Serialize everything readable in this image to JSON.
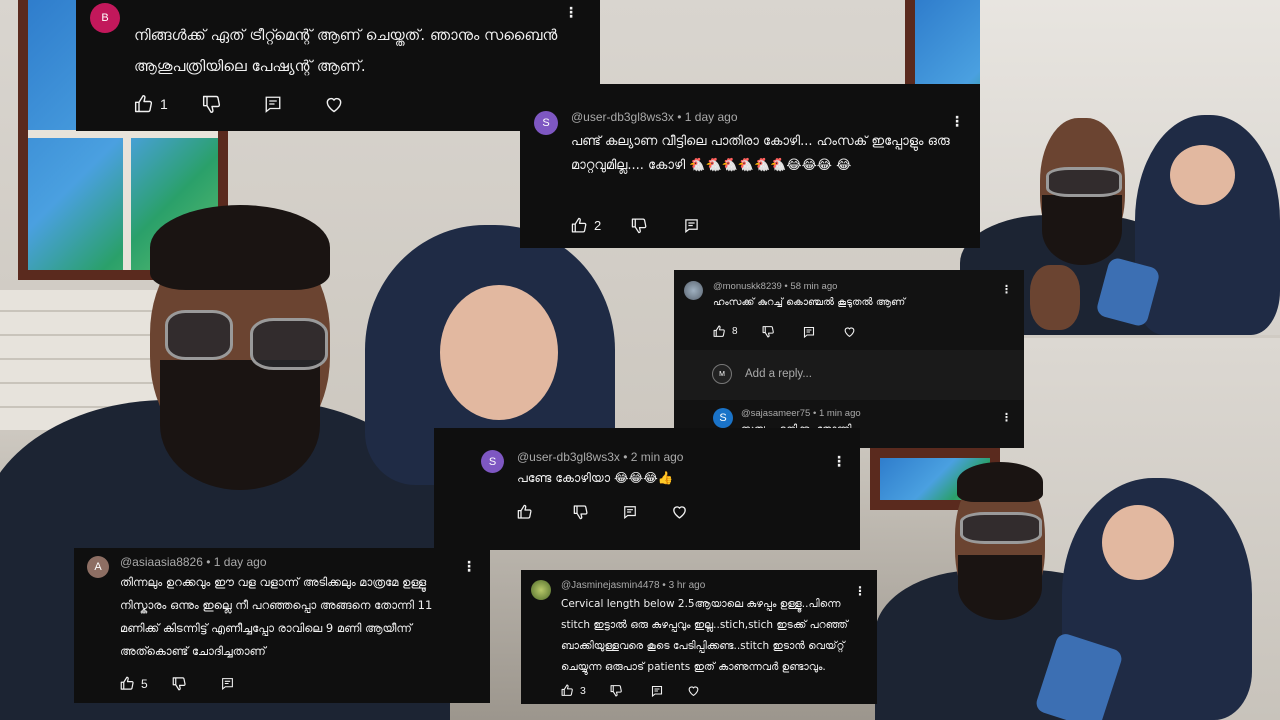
{
  "colors": {
    "card_bg": "#0f0f0f",
    "text": "#f1f1f1",
    "meta": "#aaaaaa",
    "avatar_purple": "#7e57c2",
    "avatar_blue": "#1a73c8",
    "avatar_brown": "#8d6e63"
  },
  "comments": [
    {
      "id": "c1",
      "avatar_letter": "B",
      "author": "",
      "time": "",
      "text": "നിങ്ങൾക്ക് ഏത് ട്രീറ്റ്മെന്റ് ആണ് ചെയ്തത്. ഞാനും സബൈൻ ആശുപത്രിയിലെ പേഷ്യന്റ് ആണ്.",
      "likes": "1"
    },
    {
      "id": "c2",
      "avatar_letter": "S",
      "author": "@user-db3gl8ws3x",
      "time": "1 day ago",
      "text": "പണ്ട് കല്യാണ വീട്ടിലെ പാതിരാ കോഴി... ഹംസക് ഇപ്പോളും ഒരു മാറ്റവുമില്ല.... കോഴി 🐔🐔🐔🐔🐔🐔😂😂😂 😂",
      "likes": "2"
    },
    {
      "id": "c3",
      "avatar_letter": "",
      "author": "@monuskk8239",
      "time": "58 min ago",
      "text": "ഹംസക്ക് കുറച്ച് കൊഞ്ചൽ കൂടുതൽ ആണ്",
      "likes": "8",
      "reply_placeholder": "Add a reply...",
      "reply": {
        "avatar_letter": "S",
        "author": "@sajasameer75",
        "time": "1 min ago",
        "text": "സത്യം എനിക്കും തോന്നി"
      }
    },
    {
      "id": "c4",
      "avatar_letter": "S",
      "author": "@user-db3gl8ws3x",
      "time": "2 min ago",
      "text": "പണ്ടേ കോഴിയാ 😂😂😂👍",
      "likes": ""
    },
    {
      "id": "c5",
      "avatar_letter": "A",
      "author": "@asiaasia8826",
      "time": "1 day ago",
      "text": "തിന്നലും ഉറക്കവും ഈ വള വളാന്ന് അടിക്കലും മാത്രമേ ഉള്ളൂ നിസ്കാരം ഒന്നും ഇല്ലെ  നീ പറഞ്ഞപ്പൊ അങ്ങനെ തോന്നി  11 മണിക്ക് കിടന്നിട്ട്  എണീച്ചപ്പോ  രാവിലെ  9 മണി ആയീന്ന് അത്കൊണ്ട് ചോദിച്ചതാണ്",
      "likes": "5"
    },
    {
      "id": "c6",
      "avatar_letter": "",
      "author": "@Jasminejasmin4478",
      "time": "3 hr ago",
      "text": "Cervical length below 2.5ആയാലെ കുഴപ്പം ഉള്ളൂ..പിന്നെ stitch ഇട്ടാൽ ഒരു കുഴപ്പവും ഇല്ല..stich,stich ഇടക്ക് പറഞ്ഞ് ബാക്കിയുള്ളവരെ കൂടെ പേടിപ്പിക്കണ്ട..stitch ഇടാൻ വെയ്റ്റ് ചെയ്യുന്ന ഒരുപാട് patients ഇത് കാണുന്നവർ ഉണ്ടാവും.",
      "likes": "3"
    }
  ]
}
